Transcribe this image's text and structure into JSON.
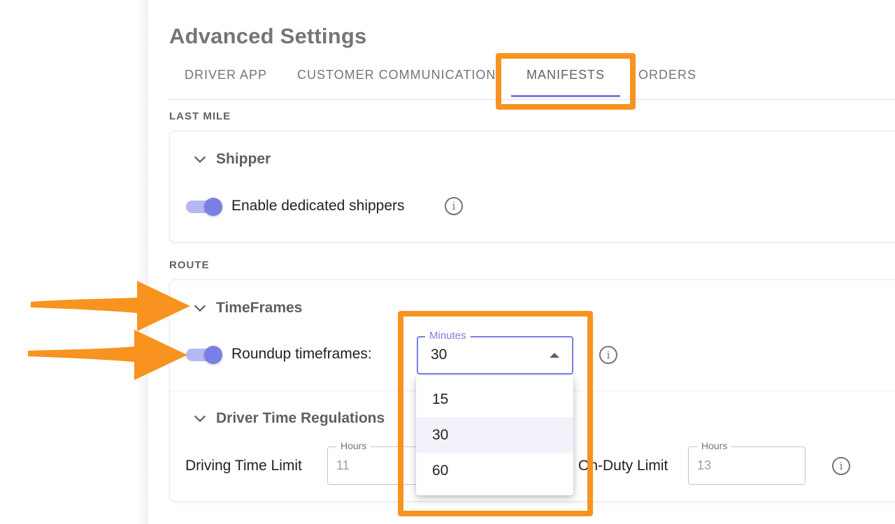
{
  "page": {
    "title": "Advanced Settings"
  },
  "tabs": [
    {
      "label": "DRIVER APP"
    },
    {
      "label": "CUSTOMER COMMUNICATION"
    },
    {
      "label": "MANIFESTS",
      "active": true
    },
    {
      "label": "ORDERS"
    }
  ],
  "sections": {
    "last_mile": {
      "label": "LAST MILE",
      "shipper": {
        "title": "Shipper",
        "toggle_label": "Enable dedicated shippers",
        "toggle_on": true
      }
    },
    "route": {
      "label": "ROUTE",
      "timeframes": {
        "title": "TimeFrames",
        "toggle_label": "Roundup timeframes:",
        "toggle_on": true,
        "select": {
          "legend": "Minutes",
          "value": "30",
          "options": [
            "15",
            "30",
            "60"
          ],
          "selected_option": "30"
        }
      },
      "driver_time": {
        "title": "Driver Time Regulations",
        "driving_label": "Driving Time Limit",
        "driving_legend": "Hours",
        "driving_value": "11",
        "onduty_label": "On-Duty Limit",
        "onduty_legend": "Hours",
        "onduty_value": "13"
      }
    }
  },
  "icons": {
    "chevron": "chevron-down-icon",
    "info": "info-icon",
    "info_glyph": "i"
  },
  "colors": {
    "accent": "#7a7fe6",
    "accent_light": "#b4b8f3",
    "annotation_orange": "#f7931e",
    "title_gray": "#757575"
  }
}
